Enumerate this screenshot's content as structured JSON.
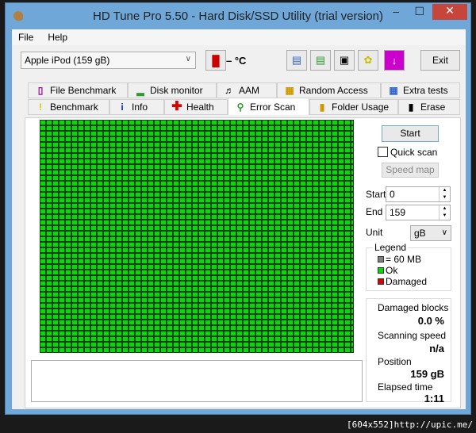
{
  "window": {
    "title": "HD Tune Pro 5.50 - Hard Disk/SSD Utility (trial version)"
  },
  "menu": {
    "file": "File",
    "help": "Help"
  },
  "toolbar": {
    "drive": "Apple   iPod (159 gB)",
    "temperature": "– °C",
    "exit": "Exit"
  },
  "tabs_top": [
    "File Benchmark",
    "Disk monitor",
    "AAM",
    "Random Access",
    "Extra tests"
  ],
  "tabs_bottom": [
    "Benchmark",
    "Info",
    "Health",
    "Error Scan",
    "Folder Usage",
    "Erase"
  ],
  "scan": {
    "start_button": "Start",
    "quick_scan": "Quick scan",
    "speed_map": "Speed map",
    "start_label": "Start",
    "start_value": "0",
    "end_label": "End",
    "end_value": "159",
    "unit_label": "Unit",
    "unit_value": "gB"
  },
  "legend": {
    "title": "Legend",
    "block": "= 60 MB",
    "ok": "Ok",
    "damaged": "Damaged"
  },
  "stats": {
    "damaged_label": "Damaged blocks",
    "damaged_value": "0.0 %",
    "speed_label": "Scanning speed",
    "speed_value": "n/a",
    "position_label": "Position",
    "position_value": "159 gB",
    "elapsed_label": "Elapsed time",
    "elapsed_value": "1:11"
  },
  "footer": "[604x552]http://upic.me/",
  "colors": {
    "ok": "#00dd00",
    "damaged": "#dd0000",
    "block": "#808080"
  }
}
